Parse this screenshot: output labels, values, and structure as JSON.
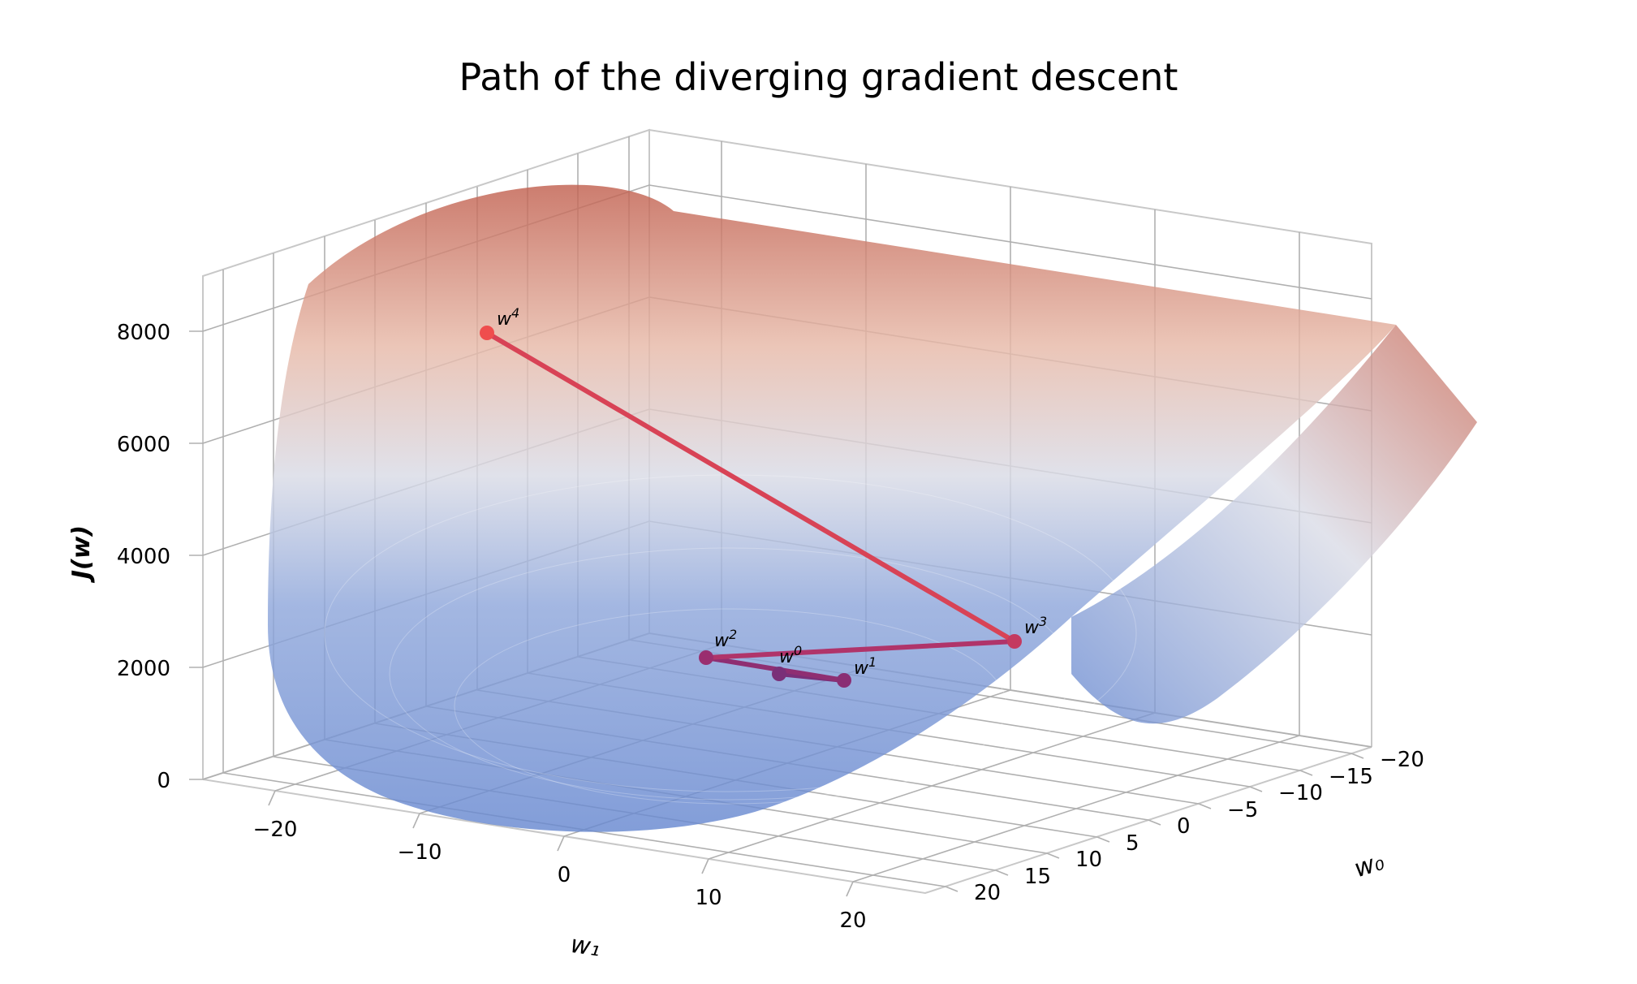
{
  "chart_data": {
    "type": "surface3d",
    "title": "Path of the diverging gradient descent",
    "xlabel": "w₁",
    "ylabel": "w₀",
    "zlabel": "J(w)",
    "x_range": [
      -25,
      25
    ],
    "y_range": [
      -22,
      22
    ],
    "z_range": [
      0,
      9000
    ],
    "x_ticks": [
      -20,
      -10,
      0,
      10,
      20
    ],
    "y_ticks": [
      -20,
      -15,
      -10,
      -5,
      0,
      5,
      10,
      15,
      20
    ],
    "z_ticks": [
      0,
      2000,
      4000,
      6000,
      8000
    ],
    "surface_colormap": "blue_to_red_by_z",
    "surface_function_hint": "quadratic bowl in w; cost J(w) of linear regression",
    "path_points": [
      {
        "label": "w⁰",
        "w1": 4.0,
        "w0": 3.0,
        "J": 350
      },
      {
        "label": "w¹",
        "w1": 6.5,
        "w0": 4.5,
        "J": 400
      },
      {
        "label": "w²",
        "w1": 1.5,
        "w0": 1.0,
        "J": 520
      },
      {
        "label": "w³",
        "w1": 14.0,
        "w0": 9.0,
        "J": 1600
      },
      {
        "label": "w⁴",
        "w1": -13.0,
        "w0": -15.0,
        "J": 8100
      }
    ],
    "path_order": [
      "w⁰",
      "w¹",
      "w²",
      "w³",
      "w⁴"
    ],
    "path_color_start": "#6a2d7b",
    "path_color_end": "#ef4d4d"
  },
  "labels": {
    "z_ticks": {
      "0": "0",
      "1": "2000",
      "2": "4000",
      "3": "6000",
      "4": "8000"
    },
    "x_ticks": {
      "0": "−20",
      "1": "−10",
      "2": "0",
      "3": "10",
      "4": "20"
    },
    "y_ticks": {
      "0": "−20",
      "1": "−15",
      "2": "−10",
      "3": "−5",
      "4": "0",
      "5": "5",
      "6": "10",
      "7": "15",
      "8": "20"
    },
    "xlabel": "w₁",
    "ylabel": "w₀",
    "zlabel": "J(w)",
    "points": {
      "0": "w",
      "0s": "0",
      "1": "w",
      "1s": "1",
      "2": "w",
      "2s": "2",
      "3": "w",
      "3s": "3",
      "4": "w",
      "4s": "4"
    }
  },
  "title": "Path of the diverging gradient descent"
}
